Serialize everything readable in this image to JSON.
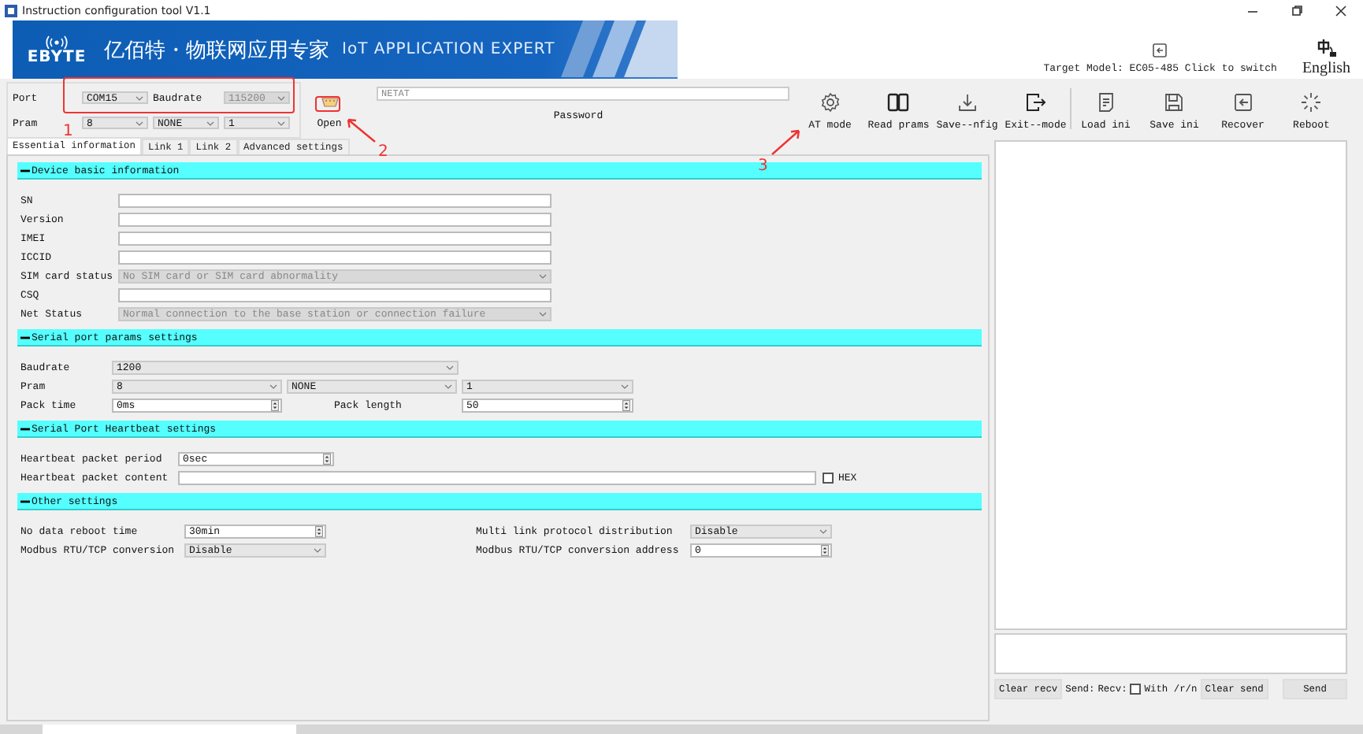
{
  "window": {
    "title": "Instruction configuration tool V1.1"
  },
  "banner": {
    "logo": "EBYTE",
    "slogan": "亿佰特・物联网应用专家",
    "tagline": "IoT APPLICATION EXPERT",
    "target_model": "Target Model: EC05-485 Click to switch",
    "language": "English"
  },
  "connection": {
    "port_label": "Port",
    "port": "COM15",
    "baud_label": "Baudrate",
    "baudrate": "115200",
    "pram_label": "Pram",
    "data_bits": "8",
    "parity": "NONE",
    "stop_bits": "1",
    "open_label": "Open"
  },
  "password": {
    "placeholder": "NETAT",
    "label": "Password"
  },
  "toolbar": [
    [
      {
        "label": "AT mode"
      },
      {
        "label": "Read prams"
      },
      {
        "label": "Save--nfig"
      },
      {
        "label": "Exit--mode"
      }
    ],
    [
      {
        "label": "Load ini"
      },
      {
        "label": "Save ini"
      },
      {
        "label": "Recover"
      },
      {
        "label": "Reboot"
      }
    ]
  ],
  "tabs": [
    {
      "label": "Essential information",
      "selected": true
    },
    {
      "label": "Link 1",
      "selected": false
    },
    {
      "label": "Link 2",
      "selected": false
    },
    {
      "label": "Advanced settings",
      "selected": false
    }
  ],
  "sections": [
    {
      "kind": "basic",
      "title": "Device basic information",
      "rows": [
        [
          {
            "kind": "label",
            "text": "SN"
          },
          {
            "kind": "text"
          }
        ],
        [
          {
            "kind": "label",
            "text": "Version"
          },
          {
            "kind": "text"
          }
        ],
        [
          {
            "kind": "label",
            "text": "IMEI"
          },
          {
            "kind": "text"
          }
        ],
        [
          {
            "kind": "label",
            "text": "ICCID"
          },
          {
            "kind": "text"
          }
        ],
        [
          {
            "kind": "label",
            "text": "SIM card status"
          },
          {
            "kind": "select",
            "value": "No SIM card or SIM card abnormality",
            "disabled": true
          }
        ],
        [
          {
            "kind": "label",
            "text": "CSQ"
          },
          {
            "kind": "text"
          }
        ],
        [
          {
            "kind": "label",
            "text": "Net Status"
          },
          {
            "kind": "select",
            "value": "Normal connection to the base station or connection failure",
            "disabled": true
          }
        ]
      ]
    },
    {
      "kind": "serial",
      "title": "Serial port params settings",
      "rows": [
        [
          {
            "kind": "label",
            "text": "Baudrate"
          },
          {
            "kind": "select",
            "value": "1200",
            "disabled": false
          }
        ],
        [
          {
            "kind": "label",
            "text": "Pram"
          },
          {
            "kind": "select",
            "value": "8",
            "disabled": false
          },
          {
            "kind": "select",
            "value": "NONE",
            "disabled": false
          },
          {
            "kind": "select",
            "value": "1",
            "disabled": false
          }
        ],
        [
          {
            "kind": "label",
            "text": "Pack time"
          },
          {
            "kind": "spin",
            "value": "0ms"
          },
          {
            "kind": "label",
            "text": "Pack length"
          },
          {
            "kind": "spin",
            "value": "50"
          }
        ]
      ]
    },
    {
      "kind": "heartbeat",
      "title": "Serial Port Heartbeat settings",
      "rows": [
        [
          {
            "kind": "label",
            "text": "Heartbeat packet period"
          },
          {
            "kind": "spin",
            "value": "0sec"
          }
        ],
        [
          {
            "kind": "label",
            "text": "Heartbeat packet content"
          },
          {
            "kind": "text"
          },
          {
            "kind": "checkbox",
            "label": "HEX",
            "checked": false
          }
        ]
      ]
    },
    {
      "kind": "other",
      "title": "Other settings",
      "rows": [
        [
          {
            "kind": "label",
            "text": "No data reboot time"
          },
          {
            "kind": "spin",
            "value": "30min"
          },
          {
            "kind": "label",
            "text": "Multi link protocol distribution"
          },
          {
            "kind": "select",
            "value": "Disable",
            "disabled": false
          }
        ],
        [
          {
            "kind": "label",
            "text": "Modbus RTU/TCP conversion"
          },
          {
            "kind": "select",
            "value": "Disable",
            "disabled": false
          },
          {
            "kind": "label",
            "text": "Modbus RTU/TCP conversion address"
          },
          {
            "kind": "spin",
            "value": "0"
          }
        ]
      ]
    }
  ],
  "console": {
    "clear_recv": "Clear recv",
    "send_label": "Send:",
    "recv_label": "Recv:",
    "newline": {
      "label": "With /r/n",
      "checked": false
    },
    "clear_send": "Clear send",
    "send": "Send"
  },
  "annotations": [
    {
      "label": "1"
    },
    {
      "label": "2"
    },
    {
      "label": "3"
    }
  ]
}
